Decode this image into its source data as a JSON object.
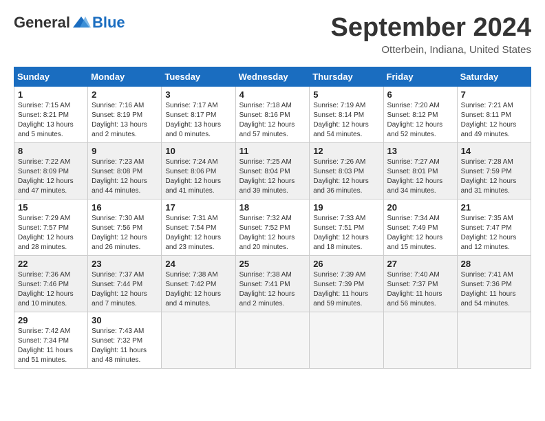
{
  "header": {
    "logo": {
      "part1": "General",
      "part2": "Blue"
    },
    "title": "September 2024",
    "location": "Otterbein, Indiana, United States"
  },
  "calendar": {
    "days_of_week": [
      "Sunday",
      "Monday",
      "Tuesday",
      "Wednesday",
      "Thursday",
      "Friday",
      "Saturday"
    ],
    "weeks": [
      [
        {
          "day": "1",
          "sunrise": "7:15 AM",
          "sunset": "8:21 PM",
          "daylight": "13 hours and 5 minutes."
        },
        {
          "day": "2",
          "sunrise": "7:16 AM",
          "sunset": "8:19 PM",
          "daylight": "13 hours and 2 minutes."
        },
        {
          "day": "3",
          "sunrise": "7:17 AM",
          "sunset": "8:17 PM",
          "daylight": "13 hours and 0 minutes."
        },
        {
          "day": "4",
          "sunrise": "7:18 AM",
          "sunset": "8:16 PM",
          "daylight": "12 hours and 57 minutes."
        },
        {
          "day": "5",
          "sunrise": "7:19 AM",
          "sunset": "8:14 PM",
          "daylight": "12 hours and 54 minutes."
        },
        {
          "day": "6",
          "sunrise": "7:20 AM",
          "sunset": "8:12 PM",
          "daylight": "12 hours and 52 minutes."
        },
        {
          "day": "7",
          "sunrise": "7:21 AM",
          "sunset": "8:11 PM",
          "daylight": "12 hours and 49 minutes."
        }
      ],
      [
        {
          "day": "8",
          "sunrise": "7:22 AM",
          "sunset": "8:09 PM",
          "daylight": "12 hours and 47 minutes."
        },
        {
          "day": "9",
          "sunrise": "7:23 AM",
          "sunset": "8:08 PM",
          "daylight": "12 hours and 44 minutes."
        },
        {
          "day": "10",
          "sunrise": "7:24 AM",
          "sunset": "8:06 PM",
          "daylight": "12 hours and 41 minutes."
        },
        {
          "day": "11",
          "sunrise": "7:25 AM",
          "sunset": "8:04 PM",
          "daylight": "12 hours and 39 minutes."
        },
        {
          "day": "12",
          "sunrise": "7:26 AM",
          "sunset": "8:03 PM",
          "daylight": "12 hours and 36 minutes."
        },
        {
          "day": "13",
          "sunrise": "7:27 AM",
          "sunset": "8:01 PM",
          "daylight": "12 hours and 34 minutes."
        },
        {
          "day": "14",
          "sunrise": "7:28 AM",
          "sunset": "7:59 PM",
          "daylight": "12 hours and 31 minutes."
        }
      ],
      [
        {
          "day": "15",
          "sunrise": "7:29 AM",
          "sunset": "7:57 PM",
          "daylight": "12 hours and 28 minutes."
        },
        {
          "day": "16",
          "sunrise": "7:30 AM",
          "sunset": "7:56 PM",
          "daylight": "12 hours and 26 minutes."
        },
        {
          "day": "17",
          "sunrise": "7:31 AM",
          "sunset": "7:54 PM",
          "daylight": "12 hours and 23 minutes."
        },
        {
          "day": "18",
          "sunrise": "7:32 AM",
          "sunset": "7:52 PM",
          "daylight": "12 hours and 20 minutes."
        },
        {
          "day": "19",
          "sunrise": "7:33 AM",
          "sunset": "7:51 PM",
          "daylight": "12 hours and 18 minutes."
        },
        {
          "day": "20",
          "sunrise": "7:34 AM",
          "sunset": "7:49 PM",
          "daylight": "12 hours and 15 minutes."
        },
        {
          "day": "21",
          "sunrise": "7:35 AM",
          "sunset": "7:47 PM",
          "daylight": "12 hours and 12 minutes."
        }
      ],
      [
        {
          "day": "22",
          "sunrise": "7:36 AM",
          "sunset": "7:46 PM",
          "daylight": "12 hours and 10 minutes."
        },
        {
          "day": "23",
          "sunrise": "7:37 AM",
          "sunset": "7:44 PM",
          "daylight": "12 hours and 7 minutes."
        },
        {
          "day": "24",
          "sunrise": "7:38 AM",
          "sunset": "7:42 PM",
          "daylight": "12 hours and 4 minutes."
        },
        {
          "day": "25",
          "sunrise": "7:38 AM",
          "sunset": "7:41 PM",
          "daylight": "12 hours and 2 minutes."
        },
        {
          "day": "26",
          "sunrise": "7:39 AM",
          "sunset": "7:39 PM",
          "daylight": "11 hours and 59 minutes."
        },
        {
          "day": "27",
          "sunrise": "7:40 AM",
          "sunset": "7:37 PM",
          "daylight": "11 hours and 56 minutes."
        },
        {
          "day": "28",
          "sunrise": "7:41 AM",
          "sunset": "7:36 PM",
          "daylight": "11 hours and 54 minutes."
        }
      ],
      [
        {
          "day": "29",
          "sunrise": "7:42 AM",
          "sunset": "7:34 PM",
          "daylight": "11 hours and 51 minutes."
        },
        {
          "day": "30",
          "sunrise": "7:43 AM",
          "sunset": "7:32 PM",
          "daylight": "11 hours and 48 minutes."
        },
        null,
        null,
        null,
        null,
        null
      ]
    ]
  }
}
